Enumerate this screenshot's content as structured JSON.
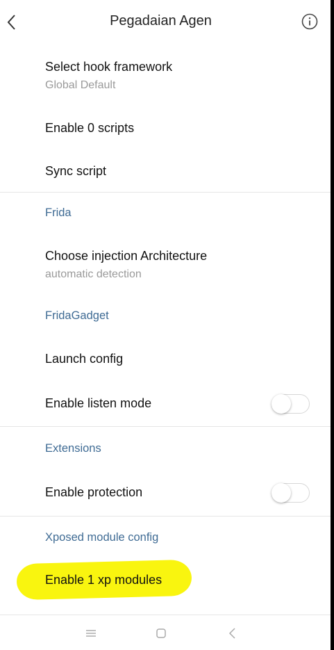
{
  "header": {
    "title": "Pegadaian Agen"
  },
  "items": {
    "hook_framework": {
      "title": "Select hook framework",
      "subtitle": "Global Default"
    },
    "enable_scripts": {
      "title": "Enable 0 scripts"
    },
    "sync_script": {
      "title": "Sync script"
    },
    "choose_arch": {
      "title": "Choose injection Architecture",
      "subtitle": "automatic detection"
    },
    "launch_config": {
      "title": "Launch config"
    },
    "listen_mode": {
      "title": "Enable listen mode",
      "enabled": false
    },
    "protection": {
      "title": "Enable protection",
      "enabled": false
    },
    "xp_modules": {
      "title": "Enable 1 xp modules"
    }
  },
  "sections": {
    "frida": "Frida",
    "frida_gadget": "FridaGadget",
    "extensions": "Extensions",
    "xposed": "Xposed module config"
  },
  "colors": {
    "section": "#3f6b94",
    "highlight": "#f9f50f"
  },
  "icons": {
    "back": "back-arrow-icon",
    "info": "info-icon",
    "menu": "menu-icon",
    "home": "home-square-icon",
    "nav_back": "nav-back-icon"
  }
}
